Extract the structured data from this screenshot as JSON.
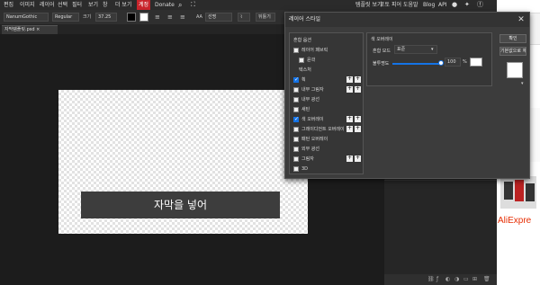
{
  "menu": {
    "items": [
      "편집",
      "이미지",
      "레이어",
      "선택",
      "필터",
      "보기",
      "창",
      "더 보기",
      "계정",
      "Donate"
    ],
    "right": [
      "템플릿 보기",
      "포토 피어",
      "도움말",
      "Blog",
      "API"
    ]
  },
  "options": {
    "font": "NanumGothic",
    "style": "Regular",
    "size_label": "크기",
    "size": "37.25",
    "aa": "AA",
    "aa_mode": "선명",
    "extra": "뒤틀기"
  },
  "tab": {
    "label": "자막템플릿.psd ×"
  },
  "canvas": {
    "subtitle": "자막을 넣어"
  },
  "dialog": {
    "title": "레이어 스타일",
    "close": "✕",
    "styles": [
      {
        "label": "혼합 옵션",
        "checked": null
      },
      {
        "label": "레이어 패브릭",
        "checked": false
      },
      {
        "label": "윤곽",
        "checked": false
      },
      {
        "label": "텍스처",
        "checked": null
      },
      {
        "label": "획",
        "checked": true
      },
      {
        "label": "내부 그림자",
        "checked": false
      },
      {
        "label": "내부 광선",
        "checked": false
      },
      {
        "label": "새틴",
        "checked": false
      },
      {
        "label": "색 오버레이",
        "checked": true
      },
      {
        "label": "그레이디언트 오버레이",
        "checked": false
      },
      {
        "label": "패턴 오버레이",
        "checked": false
      },
      {
        "label": "외부 광선",
        "checked": false
      },
      {
        "label": "그림자",
        "checked": false
      },
      {
        "label": "3D",
        "checked": false
      }
    ],
    "stroke": {
      "section": "색 오버레이",
      "blend_label": "혼합 모드",
      "blend_value": "표준",
      "opacity_label": "불투명도",
      "opacity": "100",
      "opacity_unit": "%",
      "opacity_fraction": 1.0
    },
    "ok": "확인",
    "cancel": "기본값으로 재설정"
  },
  "ad": {
    "brand": "AliExpre"
  },
  "colors": {
    "accent": "#1473e6",
    "active_menu": "#c8242b",
    "ad_red": "#e62e04"
  }
}
